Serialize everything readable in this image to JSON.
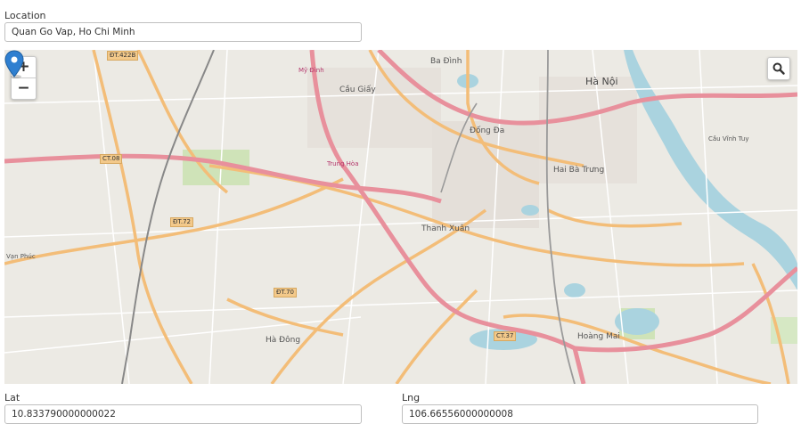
{
  "location": {
    "label": "Location",
    "value": "Quan Go Vap, Ho Chi Minh"
  },
  "map": {
    "zoom_in": "+",
    "zoom_out": "−",
    "places": {
      "ha_noi": "Hà Nội",
      "ba_dinh": "Ba Đình",
      "cau_giay": "Cầu Giấy",
      "dong_da": "Đống Đa",
      "hai_ba_trung": "Hai Bà Trưng",
      "thanh_xuan": "Thanh Xuân",
      "ha_dong": "Hà Đông",
      "hoang_mai": "Hoàng Mai",
      "cau_vinh_tuy": "Cầu Vĩnh Tuy",
      "trung_hoa": "Trung Hòa",
      "my_dinh": "Mỹ Đình",
      "van_phuc": "Vạn Phúc"
    },
    "roads": {
      "ct08": "CT.08",
      "dt72": "ĐT.72",
      "dt70": "ĐT.70",
      "ct37": "CT.37",
      "dt422b": "ĐT.422B"
    },
    "colors": {
      "primary_road": "#e8909c",
      "secondary_road": "#f7c984",
      "water": "#aad3df",
      "park": "#c8e0b0",
      "pin": "#2f7fd0"
    }
  },
  "lat": {
    "label": "Lat",
    "value": "10.833790000000022"
  },
  "lng": {
    "label": "Lng",
    "value": "106.66556000000008"
  }
}
